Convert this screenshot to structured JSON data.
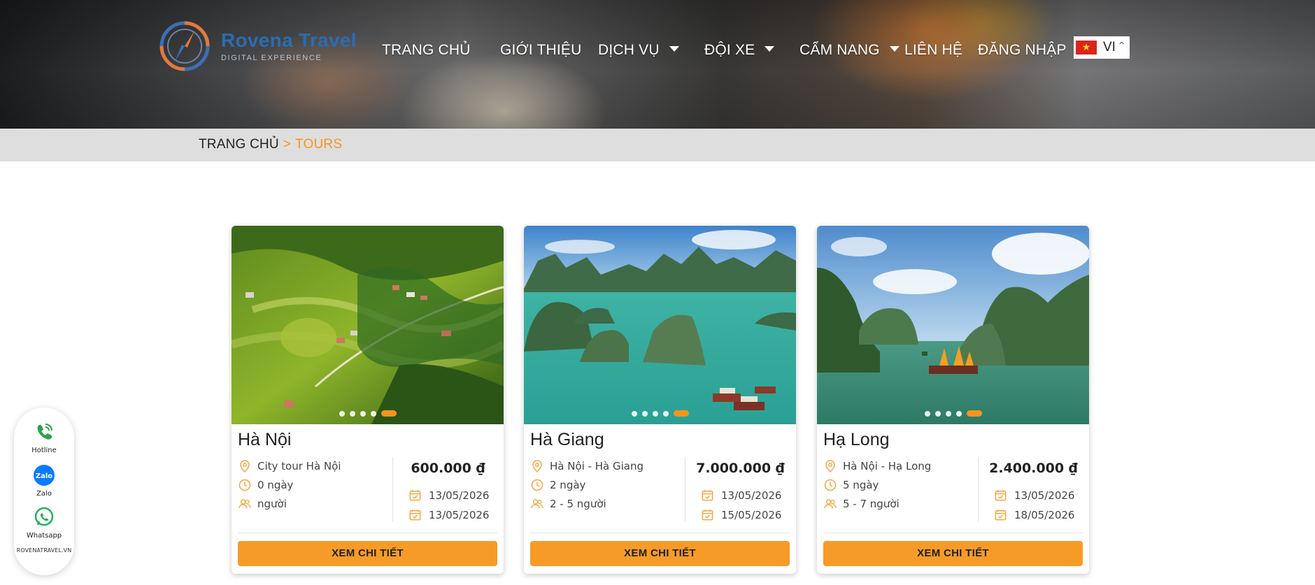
{
  "brand": {
    "name": "Rovena Travel",
    "tagline": "DIGITAL EXPERIENCE"
  },
  "nav": {
    "items": [
      {
        "label": "TRANG CHỦ",
        "has_dropdown": false
      },
      {
        "label": "GIỚI THIỆU",
        "has_dropdown": false
      },
      {
        "label": "DỊCH VỤ",
        "has_dropdown": true
      },
      {
        "label": "ĐỘI XE",
        "has_dropdown": true
      },
      {
        "label": "CẨM NANG",
        "has_dropdown": true
      },
      {
        "label": "LIÊN HỆ",
        "has_dropdown": false
      },
      {
        "label": "ĐĂNG NHẬP",
        "has_dropdown": false
      }
    ],
    "language": {
      "code": "VI",
      "flag_icon": "vietnam-flag-icon"
    }
  },
  "breadcrumb": {
    "home": "TRANG CHỦ",
    "separator": ">",
    "current": "TOURS"
  },
  "tours": [
    {
      "title": "Hà Nội",
      "route": "City tour Hà Nội",
      "duration": "0 ngày",
      "people": "người",
      "price": "600.000 ₫",
      "start_date": "13/05/2026",
      "end_date": "13/05/2026",
      "button": "XEM CHI TIẾT",
      "slides": 5,
      "active_slide": 5
    },
    {
      "title": "Hà Giang",
      "route": "Hà Nội - Hà Giang",
      "duration": "2 ngày",
      "people": "2 - 5 người",
      "price": "7.000.000 ₫",
      "start_date": "13/05/2026",
      "end_date": "15/05/2026",
      "button": "XEM CHI TIẾT",
      "slides": 5,
      "active_slide": 5
    },
    {
      "title": "Hạ Long",
      "route": "Hà Nội - Hạ Long",
      "duration": "5 ngày",
      "people": "5 - 7 người",
      "price": "2.400.000 ₫",
      "start_date": "13/05/2026",
      "end_date": "18/05/2026",
      "button": "XEM CHI TIẾT",
      "slides": 5,
      "active_slide": 5
    }
  ],
  "contact": {
    "hotline": "Hotline",
    "zalo": "Zalo",
    "zalo_logo_text": "Zalo",
    "whatsapp": "Whatsapp",
    "site": "ROVENATRAVEL.VN"
  },
  "colors": {
    "accent": "#f7941d",
    "button": "#f79b28",
    "brand_blue": "#2b6cb0"
  }
}
